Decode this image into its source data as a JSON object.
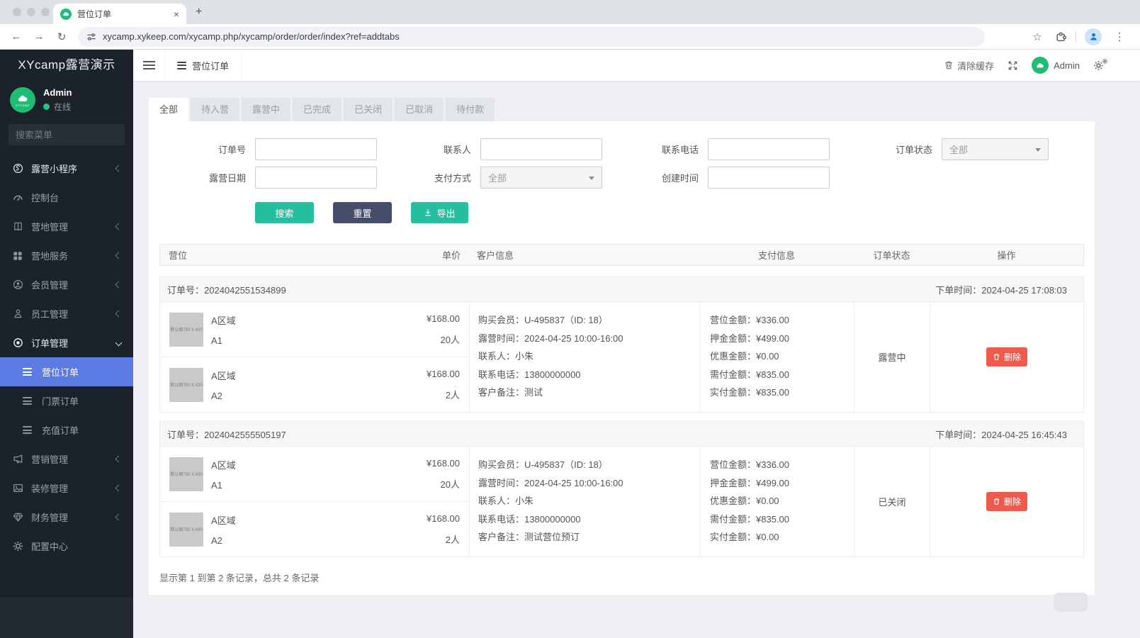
{
  "glyphs": {
    "back": "←",
    "forward": "→",
    "reload": "↻",
    "star": "☆",
    "dots": "⋮",
    "close_tab": "×",
    "new_tab": "+"
  },
  "browser": {
    "tab_title": "营位订单",
    "url": "xycamp.xykeep.com/xycamp.php/xycamp/order/order/index?ref=addtabs"
  },
  "sidebar": {
    "brand": "XYcamp露营演示",
    "user": {
      "name": "Admin",
      "status": "在线",
      "logo_text": "XYCAMP"
    },
    "search_placeholder": "搜索菜单",
    "menu": [
      {
        "label": "露营小程序"
      },
      {
        "label": "控制台"
      },
      {
        "label": "营地管理"
      },
      {
        "label": "营地服务"
      },
      {
        "label": "会员管理"
      },
      {
        "label": "员工管理"
      },
      {
        "label": "订单管理"
      },
      {
        "label": "营位订单"
      },
      {
        "label": "门票订单"
      },
      {
        "label": "充值订单"
      },
      {
        "label": "营销管理"
      },
      {
        "label": "装修管理"
      },
      {
        "label": "财务管理"
      },
      {
        "label": "配置中心"
      }
    ]
  },
  "navbar": {
    "tab": "营位订单",
    "clear_cache": "清除缓存",
    "username": "Admin"
  },
  "tabs": [
    {
      "label": "全部"
    },
    {
      "label": "待入营"
    },
    {
      "label": "露营中"
    },
    {
      "label": "已完成"
    },
    {
      "label": "已关闭"
    },
    {
      "label": "已取消"
    },
    {
      "label": "待付款"
    }
  ],
  "filter": {
    "labels": {
      "order_no": "订单号",
      "contact": "联系人",
      "phone": "联系电话",
      "order_status": "订单状态",
      "camp_date": "露营日期",
      "pay_method": "支付方式",
      "created_at": "创建时间"
    },
    "selects": {
      "order_status_value": "全部",
      "pay_method_value": "全部"
    },
    "buttons": {
      "search": "搜索",
      "reset": "重置",
      "export": "导出"
    }
  },
  "table": {
    "headers": {
      "camp": "营位",
      "unit_price": "单价",
      "customer": "客户信息",
      "payment": "支付信息",
      "status": "订单状态",
      "actions": "操作"
    }
  },
  "orders": [
    {
      "order_no": "订单号：2024042551534899",
      "order_time": "下单时间：2024-04-25 17:08:03",
      "items": [
        {
          "zone": "A区域",
          "name": "A1",
          "price": "¥168.00",
          "people": "20人",
          "thumb_text": "默认图750 X 430"
        },
        {
          "zone": "A区域",
          "name": "A2",
          "price": "¥168.00",
          "people": "2人",
          "thumb_text": "默认图750 X 430"
        }
      ],
      "customer_lines": [
        "购买会员：U-495837（ID: 18）",
        "露营时间：2024-04-25 10:00-16:00",
        "联系人：小朱",
        "联系电话：13800000000",
        "客户备注：测试"
      ],
      "payment_lines": [
        "营位金额：¥336.00",
        "押金金额：¥499.00",
        "优惠金额：¥0.00",
        "需付金额：¥835.00",
        "实付金额：¥835.00"
      ],
      "status": "露营中",
      "delete_label": "删除"
    },
    {
      "order_no": "订单号：2024042555505197",
      "order_time": "下单时间：2024-04-25 16:45:43",
      "items": [
        {
          "zone": "A区域",
          "name": "A1",
          "price": "¥168.00",
          "people": "20人",
          "thumb_text": "默认图750 X 430"
        },
        {
          "zone": "A区域",
          "name": "A2",
          "price": "¥168.00",
          "people": "2人",
          "thumb_text": "默认图750 X 430"
        }
      ],
      "customer_lines": [
        "购买会员：U-495837（ID: 18）",
        "露营时间：2024-04-25 10:00-16:00",
        "联系人：小朱",
        "联系电话：13800000000",
        "客户备注：测试营位预订"
      ],
      "payment_lines": [
        "营位金额：¥336.00",
        "押金金额：¥499.00",
        "优惠金额：¥0.00",
        "需付金额：¥835.00",
        "实付金额：¥0.00"
      ],
      "status": "已关闭",
      "delete_label": "删除"
    }
  ],
  "footer": {
    "summary": "显示第 1 到第 2 条记录，总共 2 条记录"
  },
  "colors": {
    "accent_teal": "#25bf9f",
    "dark_button": "#454d6b",
    "danger_red": "#ef5a4c",
    "active_blue": "#5b7be3",
    "sidebar_bg": "#1b222a",
    "brand_green": "#1fbd74"
  }
}
